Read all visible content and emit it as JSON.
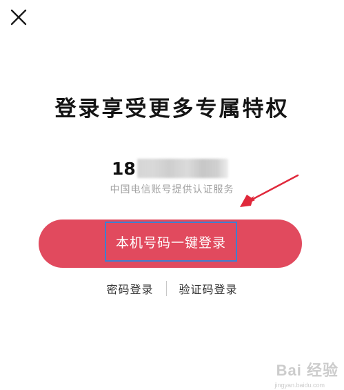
{
  "header": {
    "close_icon": "close-icon"
  },
  "main": {
    "title": "登录享受更多专属特权",
    "phone_prefix": "18",
    "service_note": "中国电信账号提供认证服务",
    "login_button_label": "本机号码一键登录",
    "alt_login": {
      "password_label": "密码登录",
      "code_label": "验证码登录"
    }
  },
  "overlay": {
    "watermark_text": "Bai 经验",
    "watermark_url": "jingyan.baidu.com"
  },
  "colors": {
    "button_bg": "#e14a5e",
    "highlight_border": "#3e7fd0",
    "arrow": "#e0283b",
    "note_text": "#a0a0a0"
  }
}
